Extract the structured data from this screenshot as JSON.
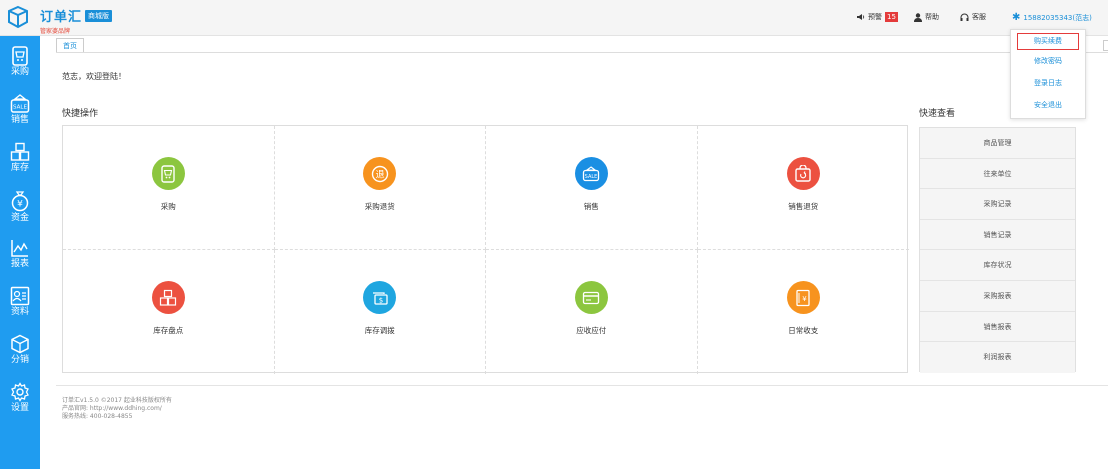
{
  "header": {
    "brand_name": "订单汇",
    "brand_badge": "商城版",
    "brand_sub": "管家婆品牌",
    "warn_label": "预警",
    "warn_count": "15",
    "help_label": "帮助",
    "service_label": "客服",
    "user_label": "15882035343(范志)"
  },
  "dropdown": {
    "items": [
      "购买续费",
      "修改密码",
      "登录日志",
      "安全退出"
    ]
  },
  "sidebar": {
    "items": [
      {
        "label": "采购",
        "icon": "purchase-icon"
      },
      {
        "label": "销售",
        "icon": "sale-icon"
      },
      {
        "label": "库存",
        "icon": "inventory-icon"
      },
      {
        "label": "资金",
        "icon": "funds-icon"
      },
      {
        "label": "报表",
        "icon": "report-icon"
      },
      {
        "label": "资料",
        "icon": "profile-icon"
      },
      {
        "label": "分销",
        "icon": "distribution-icon"
      },
      {
        "label": "设置",
        "icon": "settings-icon"
      }
    ]
  },
  "tabs": [
    "首页"
  ],
  "main": {
    "welcome": "范志，欢迎登陆！",
    "quick_ops_title": "快捷操作",
    "quick_view_title": "快速查看",
    "quick_ops": [
      {
        "label": "采购",
        "icon": "purchase-icon",
        "color": "#8cc63f"
      },
      {
        "label": "采购退货",
        "icon": "purchase-return-icon",
        "color": "#f7931e"
      },
      {
        "label": "销售",
        "icon": "sale-icon",
        "color": "#1a8fe3"
      },
      {
        "label": "销售退货",
        "icon": "sale-return-icon",
        "color": "#ec5140"
      },
      {
        "label": "库存盘点",
        "icon": "stocktake-icon",
        "color": "#ec5140"
      },
      {
        "label": "库存调拨",
        "icon": "transfer-icon",
        "color": "#1fa6e0"
      },
      {
        "label": "应收应付",
        "icon": "receivable-icon",
        "color": "#8cc63f"
      },
      {
        "label": "日常收支",
        "icon": "daily-expense-icon",
        "color": "#f7931e"
      }
    ],
    "quick_view": [
      "商品管理",
      "往来单位",
      "采购记录",
      "销售记录",
      "库存状况",
      "采购报表",
      "销售报表",
      "利润报表"
    ]
  },
  "footer": {
    "line1": "订单汇v1.5.0 ©2017 起业科技版权所有",
    "line2": "产品官网: http://www.ddhing.com/",
    "line3": "服务热线: 400-028-4855"
  }
}
